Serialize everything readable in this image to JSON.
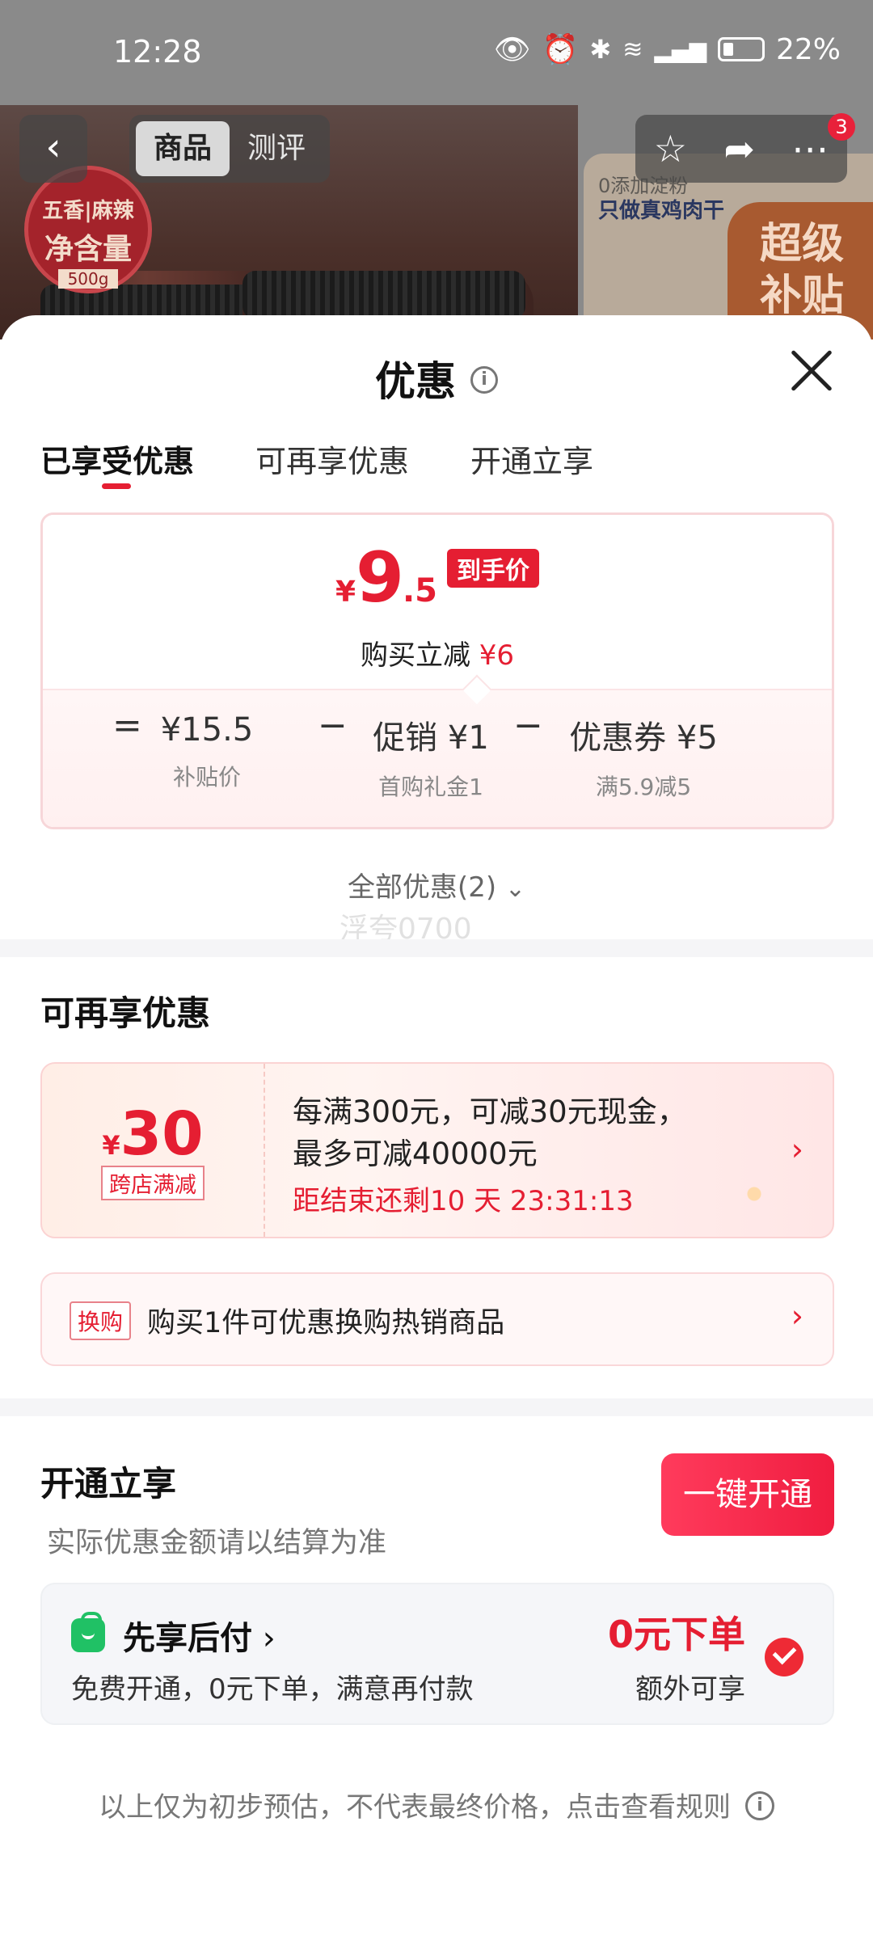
{
  "status_bar": {
    "time": "12:28",
    "battery": "22%"
  },
  "product_nav": {
    "tabs": [
      "商品",
      "测评"
    ],
    "badge_count": "3"
  },
  "background_product": {
    "seal": {
      "line1": "五香|麻辣",
      "line2": "净含量",
      "line3": "500g"
    },
    "banner": {
      "line1": "0添加淀粉",
      "line2": "只做真鸡肉干",
      "badge": "超级补贴"
    }
  },
  "sheet": {
    "title": "优惠",
    "tabs": [
      "已享受优惠",
      "可再享优惠",
      "开通立享"
    ],
    "price_card": {
      "currency": "¥",
      "price_int": "9",
      "price_dec": ".5",
      "price_tag": "到手价",
      "reduce_label": "购买立减",
      "reduce_amount": "¥6",
      "breakdown": [
        {
          "op": "=",
          "value": "¥15.5",
          "label": "补贴价"
        },
        {
          "op": "−",
          "value": "促销 ¥1",
          "label": "首购礼金1"
        },
        {
          "op": "−",
          "value": "优惠券 ¥5",
          "label": "满5.9减5"
        }
      ]
    },
    "all_discounts": "全部优惠(2)",
    "watermark": "浮夸0700",
    "more_section": {
      "title": "可再享优惠",
      "promo": {
        "currency": "¥",
        "amount": "30",
        "tag": "跨店满减",
        "line1": "每满300元，可减30元现金，",
        "line2": "最多可减40000元",
        "countdown": "距结束还剩10 天 23:31:13"
      },
      "exchange": {
        "tag": "换购",
        "text": "购买1件可优惠换购热销商品"
      }
    },
    "open_section": {
      "title": "开通立享",
      "subtitle": "实际优惠金额请以结算为准",
      "button": "一键开通",
      "pay_later": {
        "title": "先享后付",
        "subtitle": "免费开通，0元下单，满意再付款",
        "amount": "0元下单",
        "extra": "额外可享"
      }
    },
    "footer_note": "以上仅为初步预估，不代表最终价格，点击查看规则"
  }
}
